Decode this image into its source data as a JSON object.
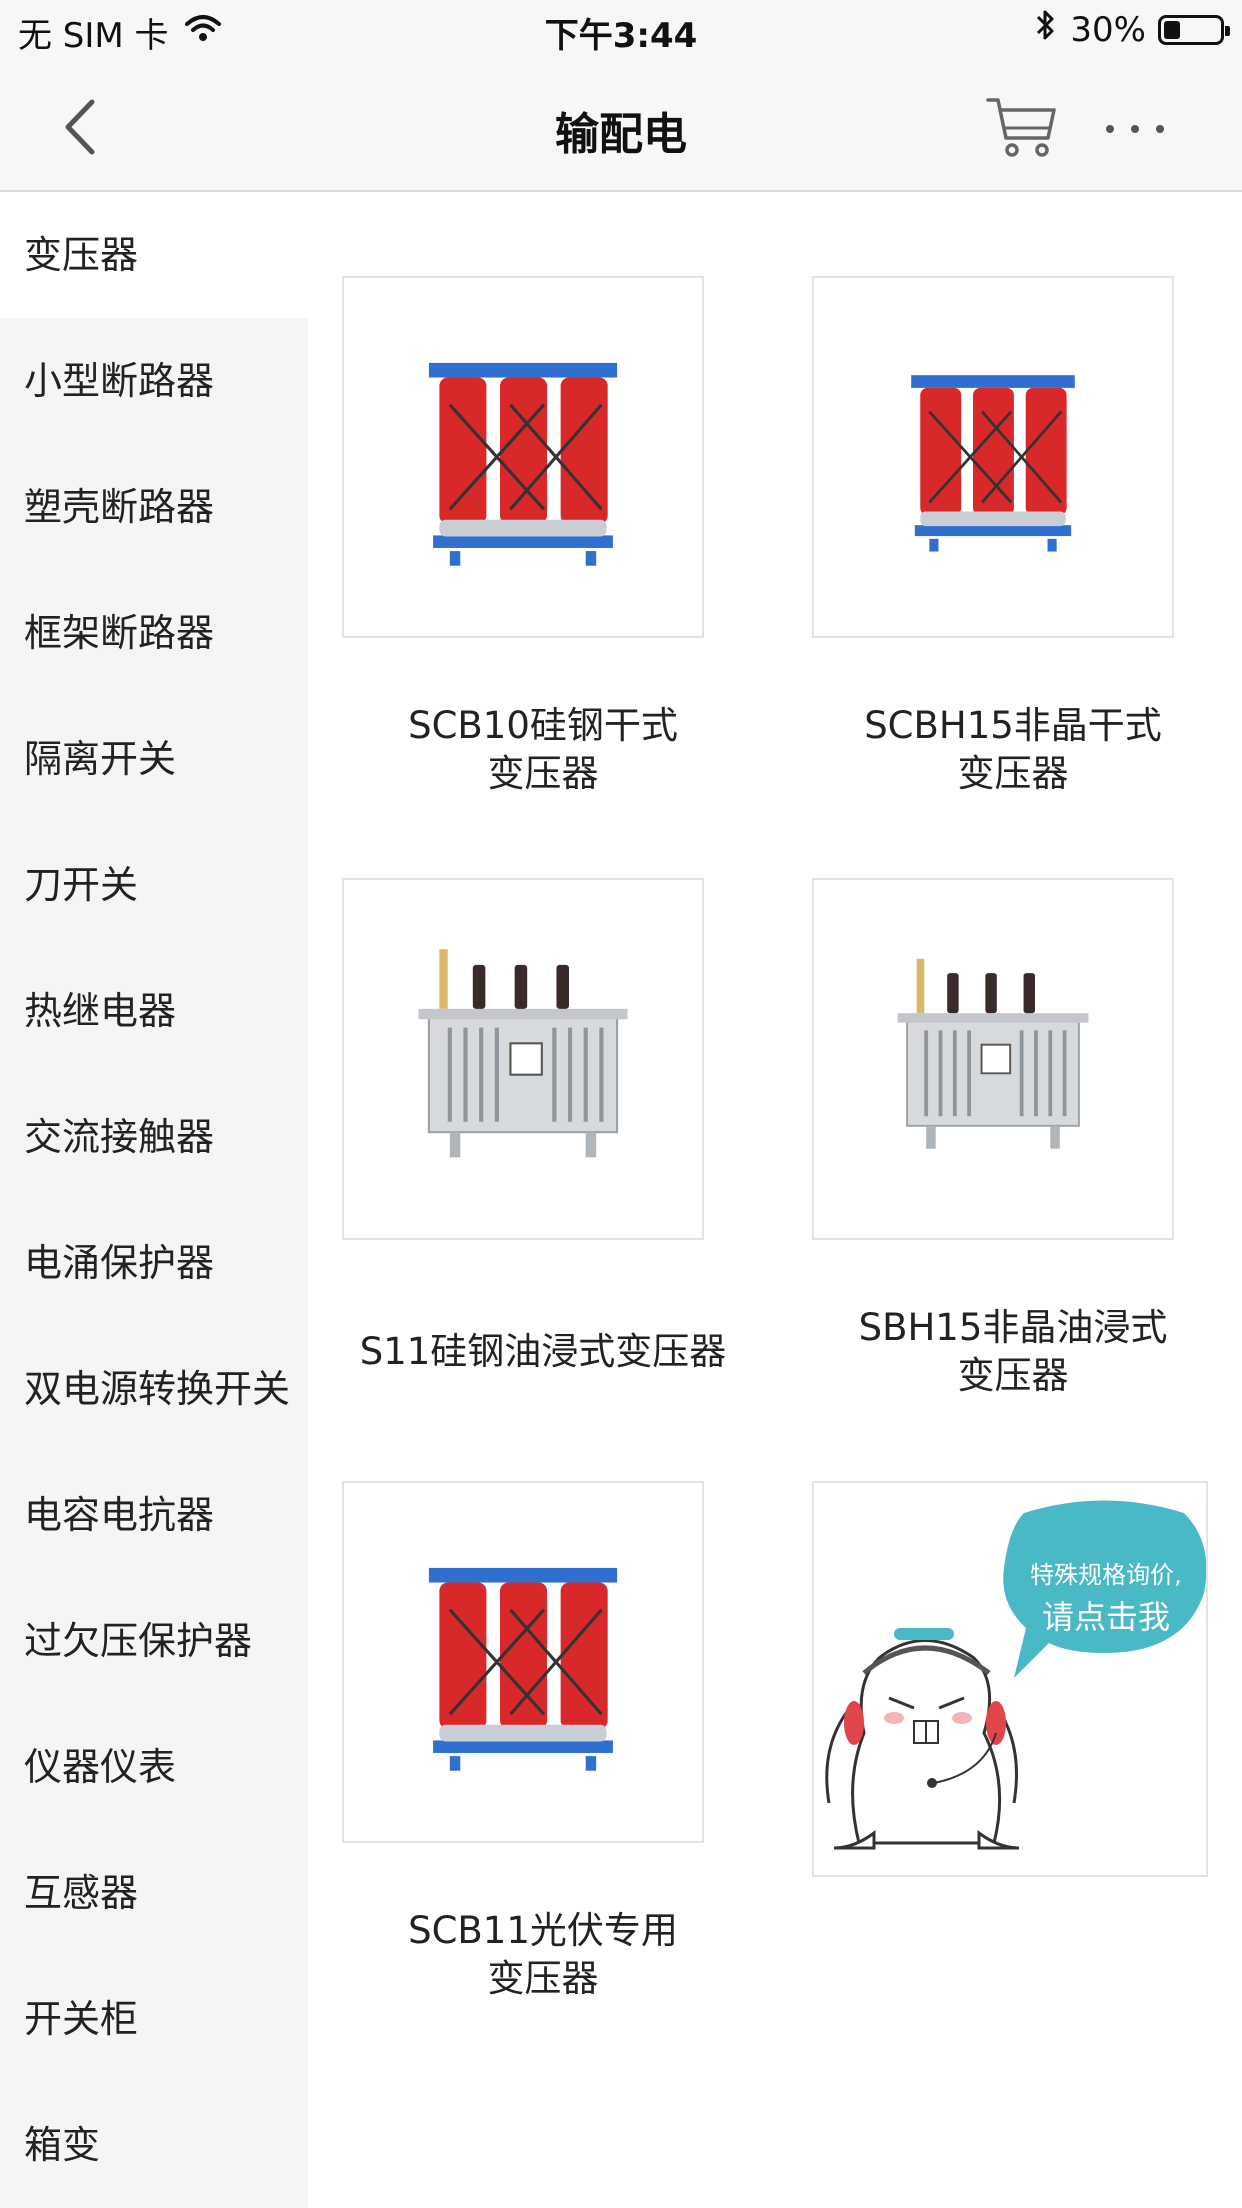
{
  "status_bar": {
    "carrier": "无 SIM 卡",
    "time": "下午3:44",
    "battery": "30%",
    "battery_level": 0.3
  },
  "nav": {
    "title": "输配电"
  },
  "sidebar": {
    "items": [
      {
        "label": "变压器",
        "active": true
      },
      {
        "label": "小型断路器"
      },
      {
        "label": "塑壳断路器"
      },
      {
        "label": "框架断路器"
      },
      {
        "label": "隔离开关"
      },
      {
        "label": "刀开关"
      },
      {
        "label": "热继电器"
      },
      {
        "label": "交流接触器"
      },
      {
        "label": "电涌保护器"
      },
      {
        "label": "双电源转换开关"
      },
      {
        "label": "电容电抗器"
      },
      {
        "label": "过欠压保护器"
      },
      {
        "label": "仪器仪表"
      },
      {
        "label": "互感器"
      },
      {
        "label": "开关柜"
      },
      {
        "label": "箱变"
      }
    ]
  },
  "products": [
    {
      "line1": "SCB10硅钢干式",
      "line2": "变压器",
      "type": "dry"
    },
    {
      "line1": "SCBH15非晶干式",
      "line2": "变压器",
      "type": "dry"
    },
    {
      "line1": "S11硅钢油浸式变压器",
      "line2": "",
      "type": "oil"
    },
    {
      "line1": "SBH15非晶油浸式",
      "line2": "变压器",
      "type": "oil"
    },
    {
      "line1": "SCB11光伏专用",
      "line2": "变压器",
      "type": "dry"
    }
  ],
  "inquiry": {
    "line1": "特殊规格询价,",
    "line2": "请点击我"
  },
  "colors": {
    "accent_teal": "#49b9c6",
    "transformer_red": "#d8282a",
    "frame_blue": "#2f6fd0"
  }
}
